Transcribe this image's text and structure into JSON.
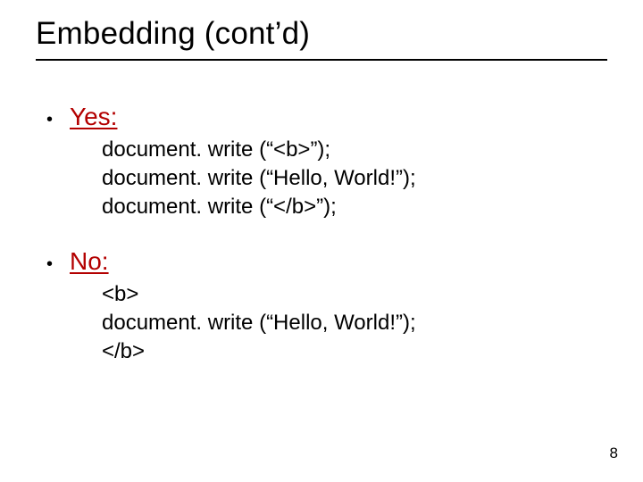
{
  "title": "Embedding (cont’d)",
  "sections": [
    {
      "label": "Yes:",
      "code": [
        "document. write (“<b>”);",
        "document. write (“Hello, World!”);",
        "document. write (“</b>”);"
      ]
    },
    {
      "label": "No:",
      "code": [
        "<b>",
        "document. write (“Hello, World!”);",
        "</b>"
      ]
    }
  ],
  "page_number": "8"
}
